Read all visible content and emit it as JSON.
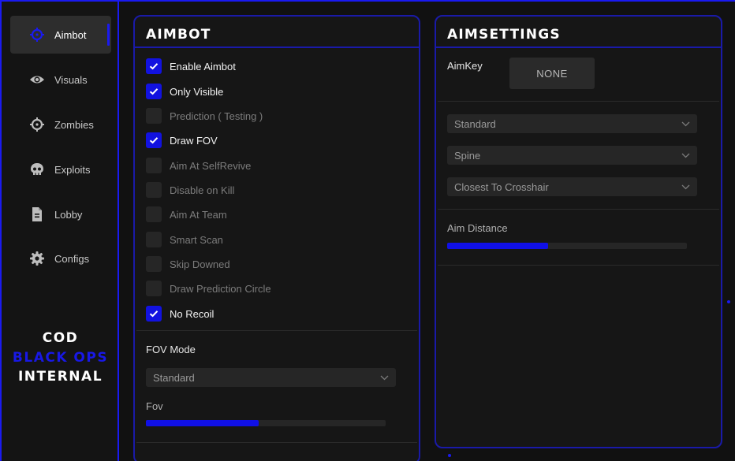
{
  "brand": {
    "line1": "COD",
    "line2": "BLACK OPS",
    "line3": "INTERNAL",
    "accent_color": "#1a1af0"
  },
  "sidebar": {
    "items": [
      {
        "label": "Aimbot",
        "icon": "crosshair-icon",
        "active": true
      },
      {
        "label": "Visuals",
        "icon": "eye-icon",
        "active": false
      },
      {
        "label": "Zombies",
        "icon": "target-icon",
        "active": false
      },
      {
        "label": "Exploits",
        "icon": "skull-icon",
        "active": false
      },
      {
        "label": "Lobby",
        "icon": "file-icon",
        "active": false
      },
      {
        "label": "Configs",
        "icon": "gear-icon",
        "active": false
      }
    ]
  },
  "aimbot_panel": {
    "title": "AIMBOT",
    "options": [
      {
        "label": "Enable Aimbot",
        "checked": true
      },
      {
        "label": "Only Visible",
        "checked": true
      },
      {
        "label": "Prediction ( Testing )",
        "checked": false
      },
      {
        "label": "Draw FOV",
        "checked": true
      },
      {
        "label": "Aim At SelfRevive",
        "checked": false
      },
      {
        "label": "Disable on Kill",
        "checked": false
      },
      {
        "label": "Aim At Team",
        "checked": false
      },
      {
        "label": "Smart Scan",
        "checked": false
      },
      {
        "label": "Skip Downed",
        "checked": false
      },
      {
        "label": "Draw Prediction Circle",
        "checked": false
      },
      {
        "label": "No Recoil",
        "checked": true
      }
    ],
    "fov_mode": {
      "label": "FOV Mode",
      "value": "Standard"
    },
    "fov": {
      "label": "Fov",
      "fraction": 0.47
    }
  },
  "aimsettings_panel": {
    "title": "AIMSETTINGS",
    "aimkey": {
      "label": "AimKey",
      "value": "NONE"
    },
    "selects": [
      {
        "name": "aim-mode-select",
        "value": "Standard"
      },
      {
        "name": "aim-bone-select",
        "value": "Spine"
      },
      {
        "name": "target-priority-select",
        "value": "Closest To Crosshair"
      }
    ],
    "aim_distance": {
      "label": "Aim Distance",
      "fraction": 0.42
    }
  }
}
